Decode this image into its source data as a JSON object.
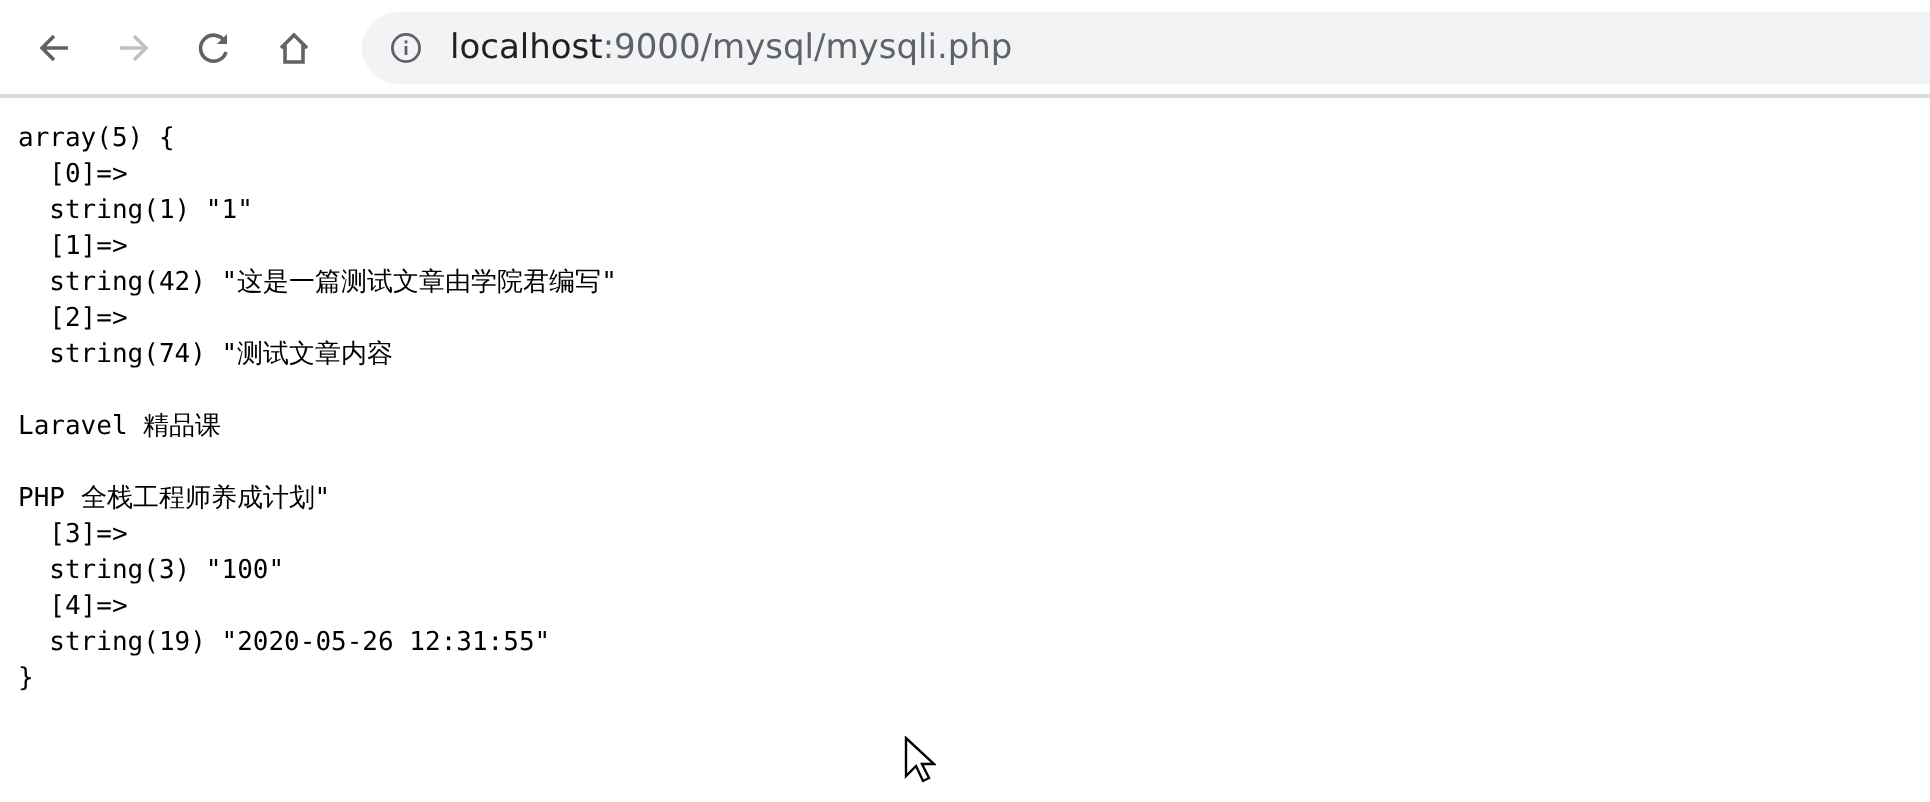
{
  "toolbar": {
    "back_disabled": false,
    "forward_disabled": true,
    "address": {
      "host": "localhost",
      "path": ":9000/mysql/mysqli.php"
    }
  },
  "output": [
    [
      "array(5) {",
      "  [0]=>",
      "  string(1) \"1\"",
      "  [1]=>",
      "  string(42) \"这是一篇测试文章由学院君编写\"",
      "  [2]=>",
      "  string(74) \"测试文章内容"
    ],
    [
      "Laravel 精品课"
    ],
    [
      "PHP 全栈工程师养成计划\"",
      "  [3]=>",
      "  string(3) \"100\"",
      "  [4]=>",
      "  string(19) \"2020-05-26 12:31:55\"",
      "}"
    ]
  ]
}
